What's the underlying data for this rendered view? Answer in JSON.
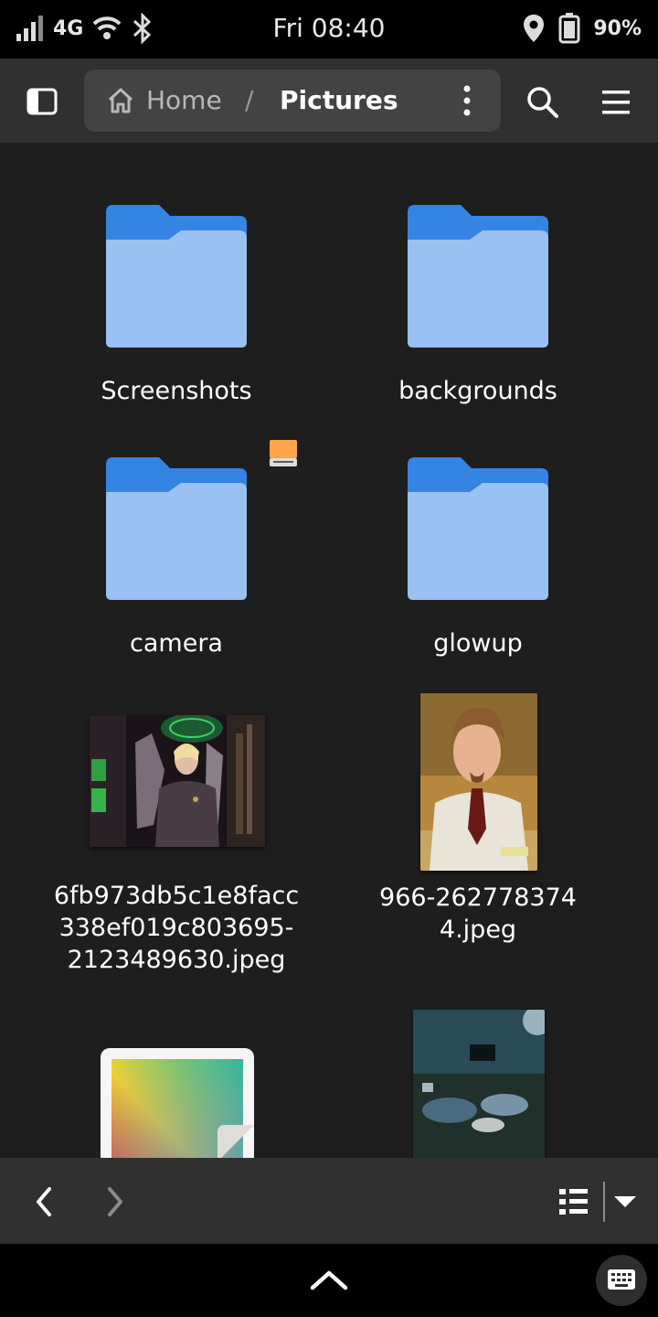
{
  "status": {
    "network": "4G",
    "time": "Fri 08:40",
    "battery": "90%"
  },
  "path": {
    "home": "Home",
    "separator": "/",
    "current": "Pictures"
  },
  "items": [
    {
      "label": "Screenshots",
      "kind": "folder"
    },
    {
      "label": "backgrounds",
      "kind": "folder"
    },
    {
      "label": "camera",
      "kind": "folder",
      "badge": "removable-drive-icon"
    },
    {
      "label": "glowup",
      "kind": "folder"
    },
    {
      "label": "6fb973db5c1e8facc\n338ef019c803695-\n2123489630.jpeg",
      "kind": "image"
    },
    {
      "label": "966-262778374\n4.jpeg",
      "kind": "image"
    },
    {
      "label": "",
      "kind": "image-placeholder"
    },
    {
      "label": "",
      "kind": "image"
    }
  ],
  "colors": {
    "folder_back": "#3584e4",
    "folder_front": "#99c1f1",
    "badge": "#ffa348"
  },
  "icons": [
    "sidebar-toggle-icon",
    "home-icon",
    "kebab-menu-icon",
    "search-icon",
    "hamburger-menu-icon",
    "back-icon",
    "forward-icon",
    "list-view-icon",
    "chevron-down-icon",
    "chevron-up-icon",
    "keyboard-icon"
  ]
}
